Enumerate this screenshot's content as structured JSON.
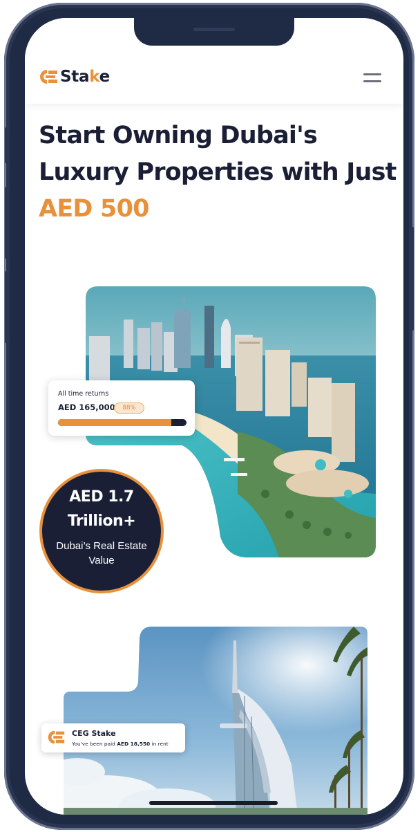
{
  "brand": {
    "logo_text_main": "Sta",
    "logo_text_accent": "k",
    "logo_text_end": "e",
    "accent_color": "#e8913a",
    "navy_color": "#1a1f36"
  },
  "header": {
    "menu_icon": "hamburger-menu-icon"
  },
  "hero": {
    "title_line1": "Start Owning Dubai's",
    "title_line2": "Luxury Properties with Just",
    "title_line3": "AED 500"
  },
  "returns_card": {
    "label": "All time returns",
    "amount": "AED 165,000",
    "percent": "88%",
    "progress": 0.88
  },
  "value_badge": {
    "line1": "AED 1.7",
    "line2": "Trillion+",
    "line3": "Dubai’s Real Estate",
    "line4": "Value"
  },
  "rent_card": {
    "title": "CEG Stake",
    "message_prefix": "You've been paid",
    "amount": "AED 18,550",
    "message_suffix": "in rent"
  }
}
